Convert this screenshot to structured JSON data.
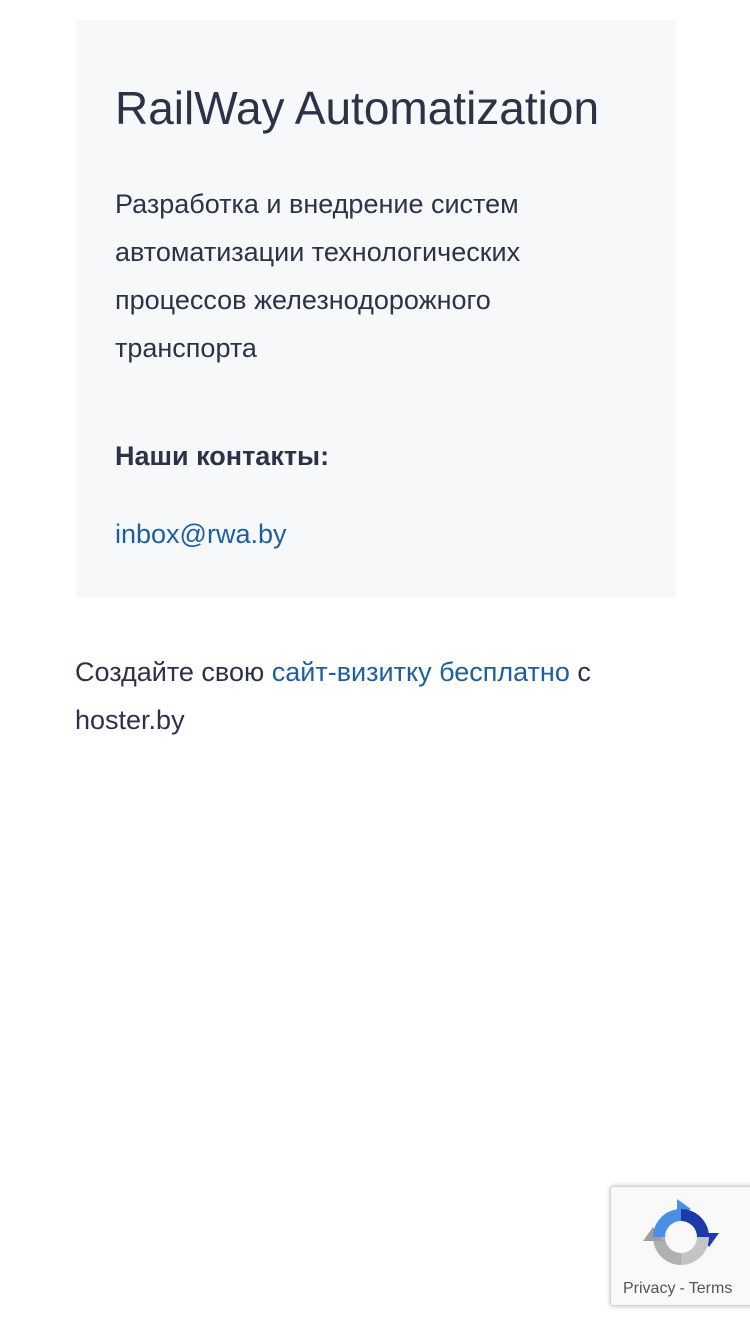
{
  "card": {
    "title": "RailWay Automatization",
    "description": "Разработка и внедрение систем автоматизации технологических процессов железнодорожного транспорта",
    "contacts_heading": "Наши контакты:",
    "email": "inbox@rwa.by"
  },
  "promo": {
    "prefix": "Создайте свою ",
    "link_text": "сайт-визитку бесплатно",
    "suffix": " с hoster.by"
  },
  "recaptcha": {
    "privacy_label": "Privacy",
    "separator": "-",
    "terms_label": "Terms",
    "logo_icon": "recaptcha-icon"
  },
  "colors": {
    "text": "#2c3349",
    "link": "#1d5fa0",
    "card_bg": "#f7f8fa",
    "recaptcha_blue": "#4a90e2",
    "recaptcha_dark_blue": "#1c3aa9",
    "recaptcha_gray": "#b0b0b0"
  }
}
